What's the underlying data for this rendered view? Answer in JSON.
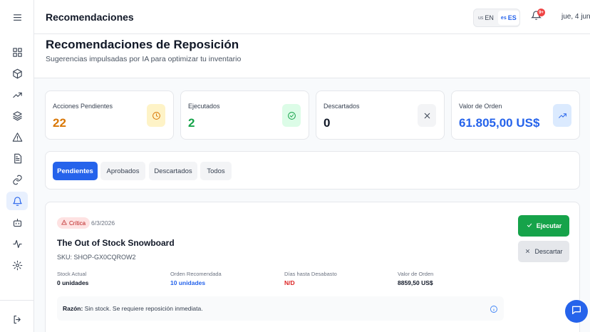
{
  "topbar": {
    "title": "Recomendaciones",
    "lang": [
      {
        "code": "us",
        "label": "EN"
      },
      {
        "code": "es",
        "label": "ES"
      }
    ],
    "notifications_badge": "9+",
    "date": "jue, 4 jun"
  },
  "sidebar": {
    "items": [
      {
        "icon": "menu-icon"
      },
      {
        "icon": "dashboard-icon"
      },
      {
        "icon": "box-icon"
      },
      {
        "icon": "trending-up-icon"
      },
      {
        "icon": "layers-icon"
      },
      {
        "icon": "alert-triangle-icon"
      },
      {
        "icon": "file-text-icon"
      },
      {
        "icon": "link-icon"
      },
      {
        "icon": "bell-icon",
        "active": true
      },
      {
        "icon": "bot-icon"
      },
      {
        "icon": "activity-icon"
      },
      {
        "icon": "settings-icon"
      },
      {
        "icon": "logout-icon"
      }
    ]
  },
  "page": {
    "title": "Recomendaciones de Reposición",
    "subtitle": "Sugerencias impulsadas por IA para optimizar tu inventario"
  },
  "stats": [
    {
      "label": "Acciones Pendientes",
      "value": "22",
      "color": "#d97706",
      "icon": "clock-icon"
    },
    {
      "label": "Ejecutados",
      "value": "2",
      "color": "#16a34a",
      "icon": "check-circle-icon"
    },
    {
      "label": "Descartados",
      "value": "0",
      "color": "#111827",
      "icon": "x-icon"
    },
    {
      "label": "Valor de Orden",
      "value": "61.805,00 US$",
      "color": "#2563eb",
      "icon": "trending-up-icon"
    }
  ],
  "tabs": [
    {
      "label": "Pendientes",
      "active": true
    },
    {
      "label": "Aprobados"
    },
    {
      "label": "Descartados"
    },
    {
      "label": "Todos"
    }
  ],
  "recommendation": {
    "priority": "Crítica",
    "date": "6/3/2026",
    "product": "The Out of Stock Snowboard",
    "sku": "SKU: SHOP-GX0CQROW2",
    "metrics": [
      {
        "label": "Stock Actual",
        "value": "0 unidades",
        "color": "#111827"
      },
      {
        "label": "Orden Recomendada",
        "value": "10 unidades",
        "color": "#2563eb"
      },
      {
        "label": "Días hasta Desabasto",
        "value": "N/D",
        "color": "#dc2626"
      },
      {
        "label": "Valor de Orden",
        "value": "8859,50 US$",
        "color": "#111827"
      }
    ],
    "reason_label": "Razón:",
    "reason_text": "Sin stock. Se requiere reposición inmediata.",
    "execute_label": "Ejecutar",
    "discard_label": "Descartar"
  }
}
